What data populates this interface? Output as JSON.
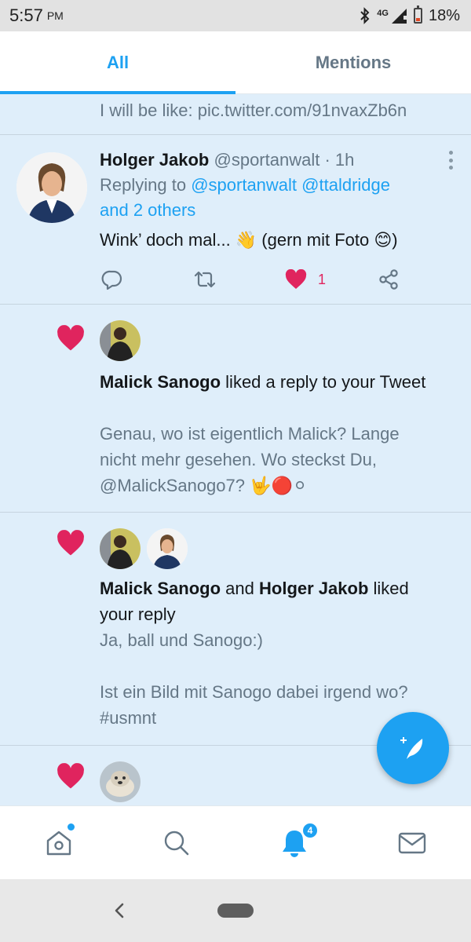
{
  "status_bar": {
    "time": "5:57",
    "ampm": "PM",
    "network": "4G",
    "battery": "18%"
  },
  "tabs": [
    {
      "label": "All",
      "active": true
    },
    {
      "label": "Mentions",
      "active": false
    }
  ],
  "feed": {
    "truncated_text": "I will be like: pic.twitter.com/91nvaxZb6n",
    "tweet": {
      "name": "Holger Jakob",
      "handle": "@sportanwalt",
      "separator": "·",
      "time": "1h",
      "replying_prefix": "Replying to",
      "replying_mentions": "@sportanwalt @ttaldridge",
      "replying_more": "and 2 others",
      "text": "Wink’ doch mal... 👋 (gern mit Foto 😊)",
      "like_count": "1"
    },
    "notification_1": {
      "name": "Malick Sanogo",
      "action": "liked a reply to your Tweet",
      "text_line1": "Genau, wo ist eigentlich Malick? Lange",
      "text_line2": "nicht mehr gesehen. Wo steckst Du,",
      "text_line3": "@MalickSanogo7? 🤟🔴⚪"
    },
    "notification_2": {
      "name1": "Malick Sanogo",
      "conjunction": "and",
      "name2": "Holger Jakob",
      "action_line1": "liked",
      "action_line2": "your reply",
      "text_line1": "Ja, ball und Sanogo:)",
      "text_line2": "Ist ein Bild mit Sanogo dabei irgend wo?",
      "text_line3": "#usmnt"
    }
  },
  "fab": {
    "icon": "compose-tweet-icon"
  },
  "bottom_nav": {
    "items": [
      {
        "icon": "home-icon"
      },
      {
        "icon": "search-icon"
      },
      {
        "icon": "notifications-icon",
        "badge": "4"
      },
      {
        "icon": "messages-icon"
      }
    ]
  },
  "colors": {
    "accent": "#1da1f2",
    "like": "#e0245e",
    "feed_background": "#dfeefa",
    "secondary_text": "#657786"
  }
}
